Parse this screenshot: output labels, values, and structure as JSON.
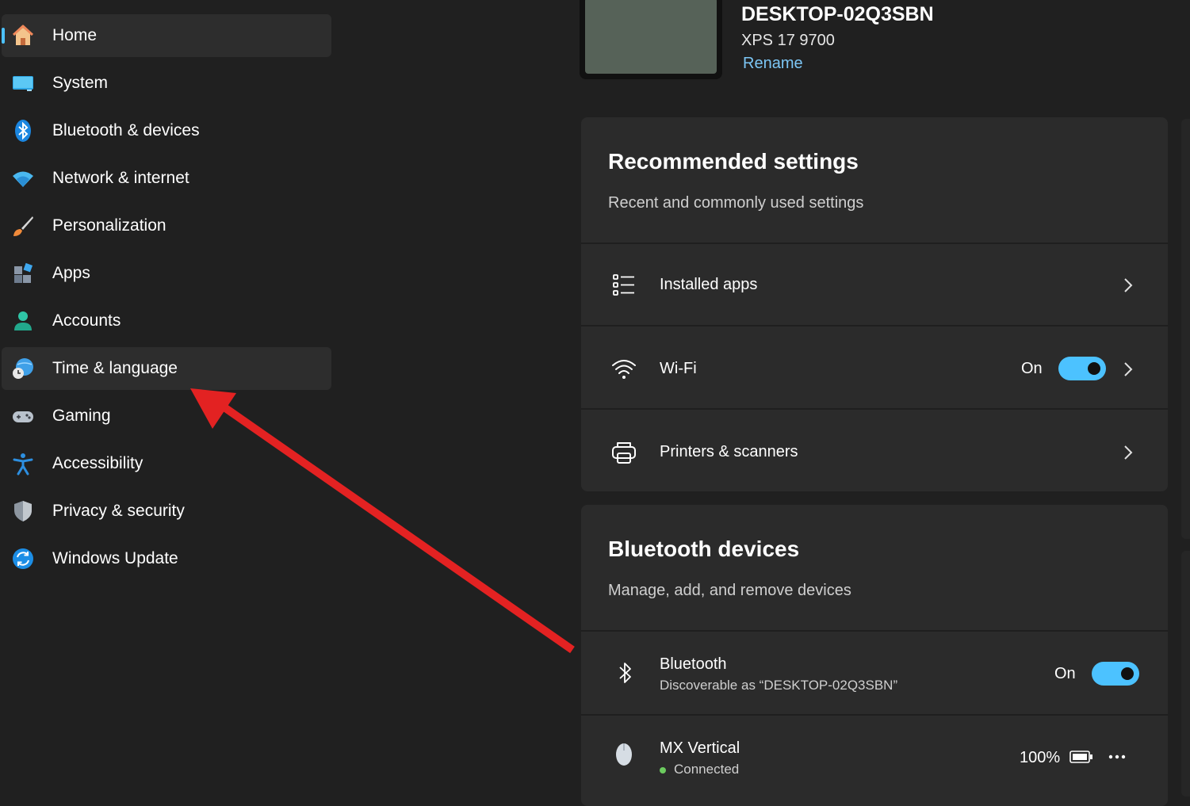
{
  "sidebar": {
    "items": [
      {
        "label": "Home",
        "icon": "home-icon"
      },
      {
        "label": "System",
        "icon": "system-icon"
      },
      {
        "label": "Bluetooth & devices",
        "icon": "bluetooth-icon"
      },
      {
        "label": "Network & internet",
        "icon": "wifi-icon"
      },
      {
        "label": "Personalization",
        "icon": "brush-icon"
      },
      {
        "label": "Apps",
        "icon": "apps-icon"
      },
      {
        "label": "Accounts",
        "icon": "account-icon"
      },
      {
        "label": "Time & language",
        "icon": "globe-clock-icon"
      },
      {
        "label": "Gaming",
        "icon": "gamepad-icon"
      },
      {
        "label": "Accessibility",
        "icon": "accessibility-icon"
      },
      {
        "label": "Privacy & security",
        "icon": "shield-icon"
      },
      {
        "label": "Windows Update",
        "icon": "update-icon"
      }
    ],
    "active_index": 0,
    "highlighted_index": 7
  },
  "device": {
    "name": "DESKTOP-02Q3SBN",
    "model": "XPS 17 9700",
    "rename_label": "Rename"
  },
  "recommended": {
    "title": "Recommended settings",
    "subtitle": "Recent and commonly used settings",
    "rows": [
      {
        "label": "Installed apps",
        "icon": "list-icon"
      },
      {
        "label": "Wi-Fi",
        "icon": "wifi-icon",
        "state": "On",
        "toggle_on": true
      },
      {
        "label": "Printers & scanners",
        "icon": "printer-icon"
      }
    ]
  },
  "bluetooth": {
    "title": "Bluetooth devices",
    "subtitle": "Manage, add, and remove devices",
    "bluetooth_row": {
      "label": "Bluetooth",
      "sub": "Discoverable as “DESKTOP-02Q3SBN”",
      "state": "On",
      "toggle_on": true
    },
    "device_row": {
      "label": "MX Vertical",
      "status": "Connected",
      "battery": "100%"
    }
  },
  "colors": {
    "accent": "#4cc2ff",
    "link": "#7cc6f5",
    "annotation_arrow": "#e32222",
    "connected_dot": "#6ccb5f"
  }
}
